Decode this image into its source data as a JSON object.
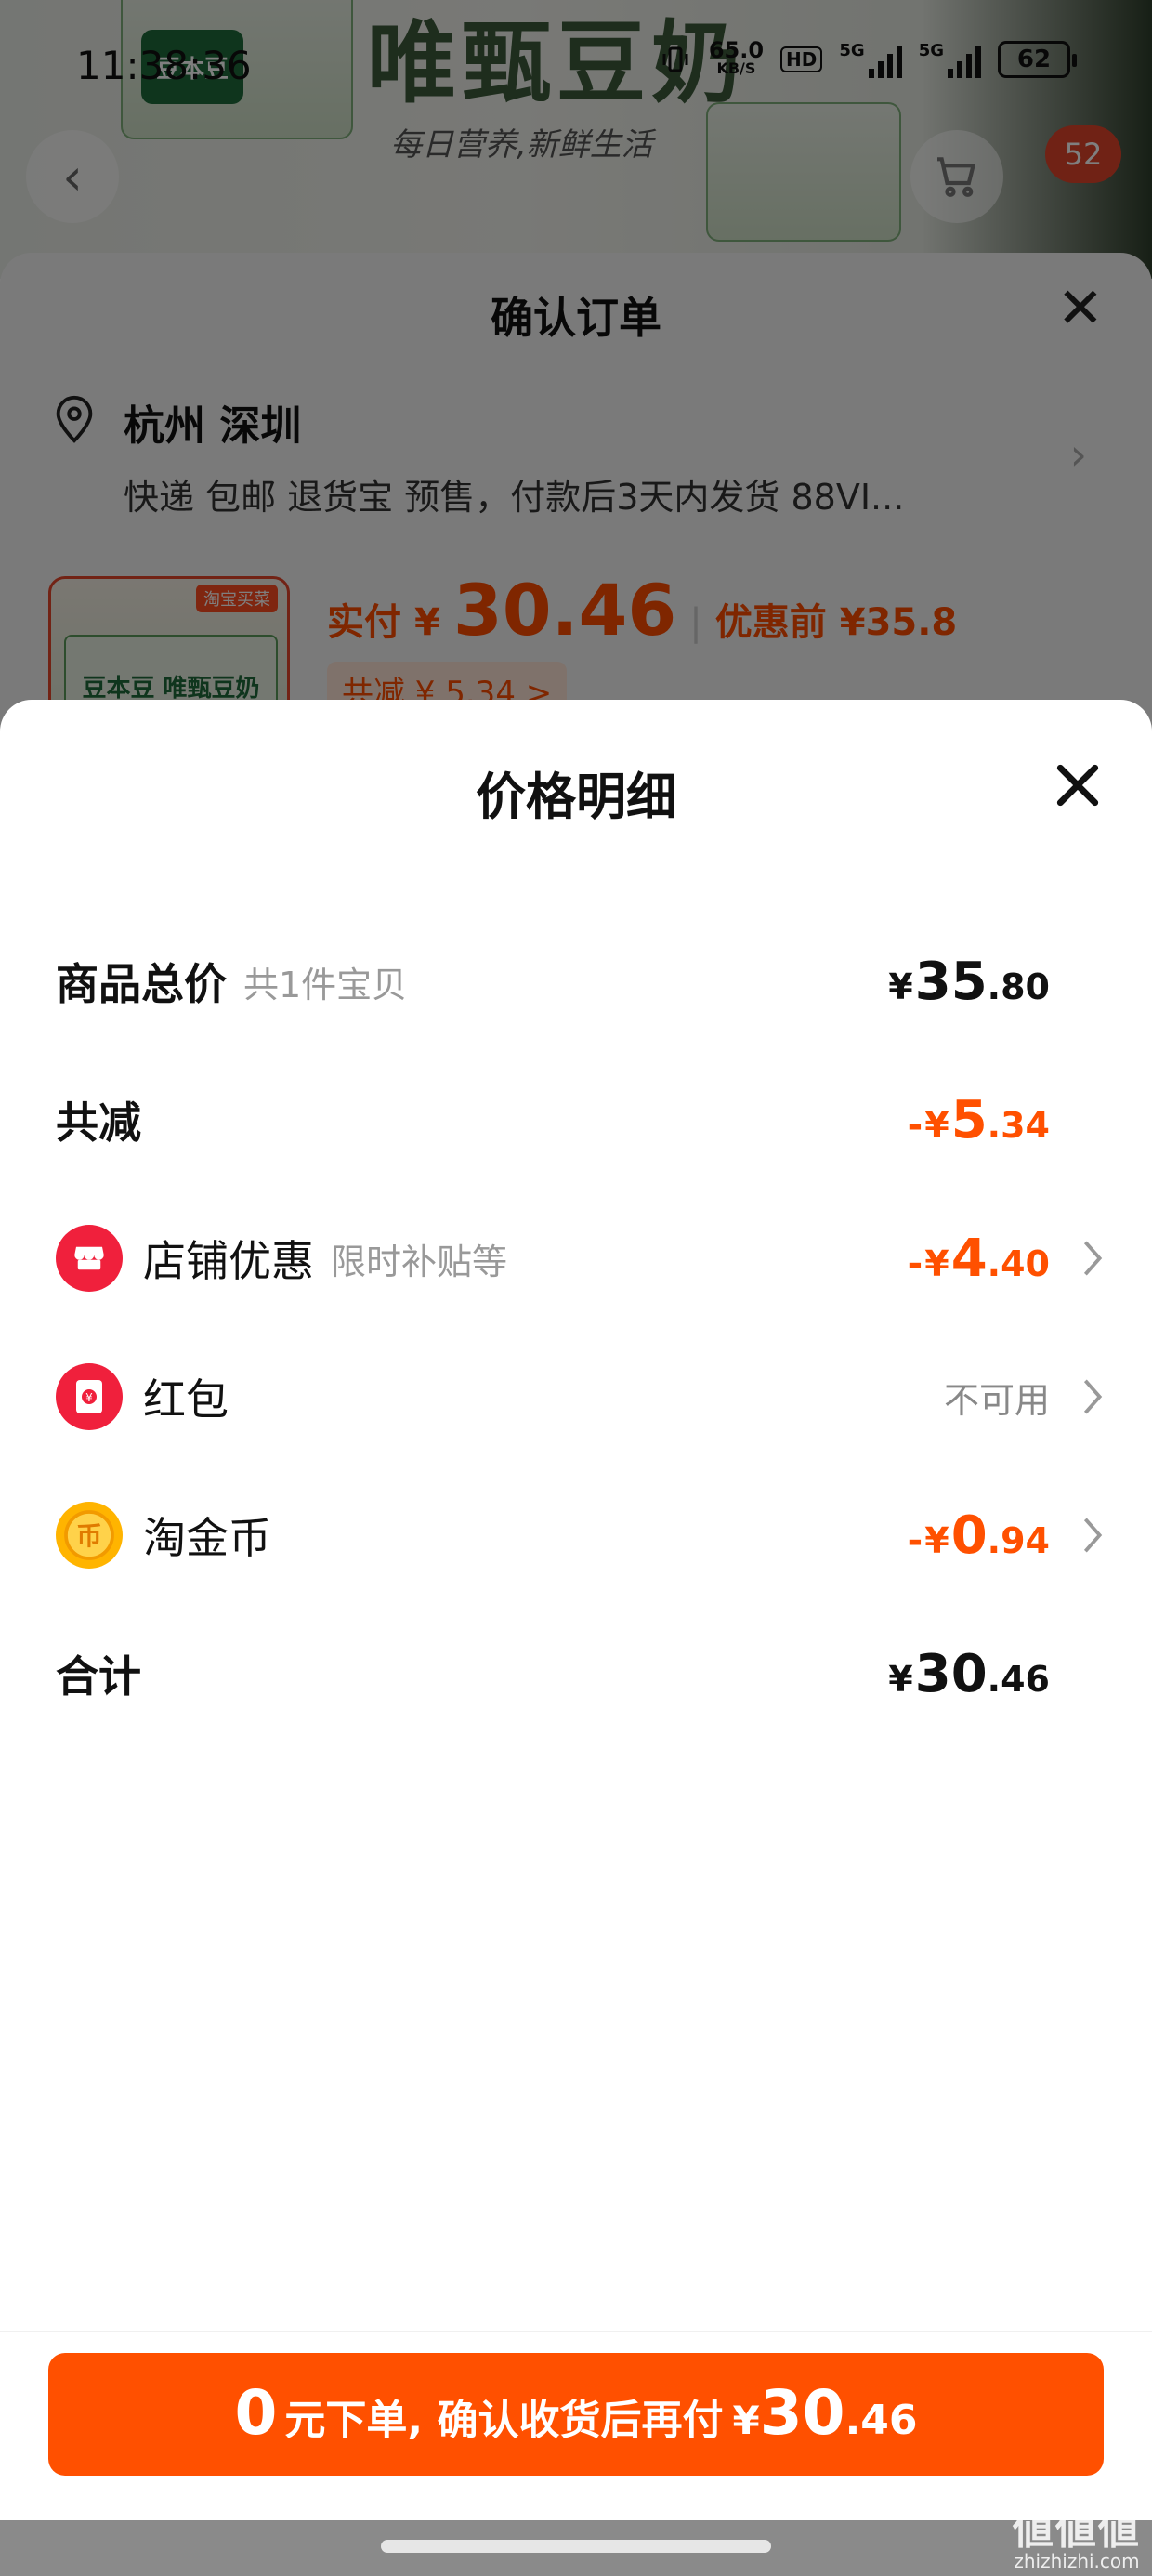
{
  "status_bar": {
    "time": "11:38:36",
    "net_speed_value": "65.0",
    "net_speed_unit": "KB/S",
    "hd_label": "HD",
    "signal1_label": "5G",
    "signal2_label": "5G",
    "battery": "62"
  },
  "background_page": {
    "headline": "唯甄豆奶",
    "tagline": "每日营养,新鲜生活",
    "brand": "豆本豆",
    "cart_badge": "52"
  },
  "confirm_order": {
    "title": "确认订单",
    "address": "杭州 深圳",
    "shipping_info": "快递 包邮 退货宝 预售，付款后3天内发货 88VI...",
    "item_thumb_brand": "豆本豆 唯甄豆奶",
    "item_thumb_tag": "淘宝买菜",
    "actual_pay_label": "实付",
    "actual_pay_currency": "¥",
    "actual_pay_amount": "30.46",
    "original_price_label": "优惠前",
    "original_price": "¥35.8",
    "total_reduce_chip": "共减 ¥ 5.34 >"
  },
  "price_detail": {
    "title": "价格明细",
    "rows": [
      {
        "label": "商品总价",
        "hint": "共1件宝贝",
        "sign": "",
        "currency": "¥",
        "int": "35",
        "dec": ".80"
      },
      {
        "label": "共减",
        "hint": "",
        "sign": "-",
        "currency": "¥",
        "int": "5",
        "dec": ".34"
      },
      {
        "label": "店铺优惠",
        "hint": "限时补贴等",
        "sign": "-",
        "currency": "¥",
        "int": "4",
        "dec": ".40"
      },
      {
        "label": "红包",
        "hint": "",
        "status": "不可用"
      },
      {
        "label": "淘金币",
        "hint": "",
        "sign": "-",
        "currency": "¥",
        "int": "0",
        "dec": ".94"
      },
      {
        "label": "合计",
        "hint": "",
        "sign": "",
        "currency": "¥",
        "int": "30",
        "dec": ".46"
      }
    ],
    "icons": [
      "shop-icon",
      "red-packet-icon",
      "taojinbi-coin-icon"
    ]
  },
  "pay_button": {
    "zero": "0",
    "text": "元下单, 确认收货后再付",
    "currency": "¥",
    "amount_int": "30",
    "amount_dec": ".46"
  },
  "watermark": {
    "logo": "値値値",
    "url": "zhizhizhi.com"
  },
  "colors": {
    "accent": "#ff5000",
    "icon_red": "#f0203c",
    "coin_yellow": "#ffb400"
  }
}
